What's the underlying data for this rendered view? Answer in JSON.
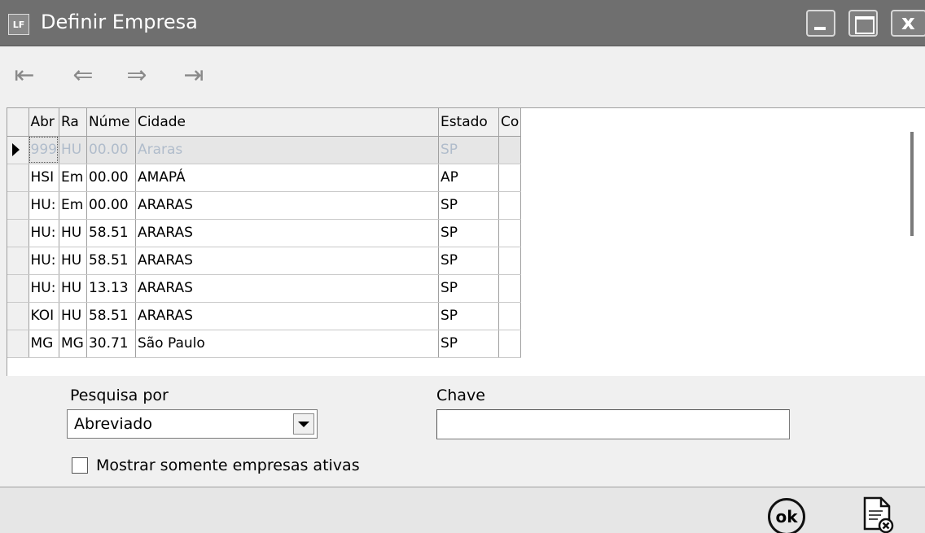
{
  "window": {
    "icon_label": "LF",
    "title": "Definir Empresa",
    "close_label": "x"
  },
  "nav": {
    "first": "⇤",
    "prev": "⇐",
    "next": "⇒",
    "last": "⇥"
  },
  "grid": {
    "headers": [
      "Abr",
      "Ra",
      "Núme",
      "Cidade",
      "Estado",
      "Co"
    ],
    "rows": [
      [
        "999",
        "HU",
        "00.00",
        "Araras",
        "SP",
        ""
      ],
      [
        "HSI",
        "Em",
        "00.00",
        "AMAPÁ",
        "AP",
        ""
      ],
      [
        "HU:",
        "Em",
        "00.00",
        "ARARAS",
        "SP",
        ""
      ],
      [
        "HU:",
        "HU",
        "58.51",
        "ARARAS",
        "SP",
        ""
      ],
      [
        "HU:",
        "HU",
        "58.51",
        "ARARAS",
        "SP",
        ""
      ],
      [
        "HU:",
        "HU",
        "13.13",
        "ARARAS",
        "SP",
        ""
      ],
      [
        "KOI",
        "HU",
        "58.51",
        "ARARAS",
        "SP",
        ""
      ],
      [
        "MG",
        "MG",
        "30.71",
        "São Paulo",
        "SP",
        ""
      ]
    ]
  },
  "search": {
    "by_label": "Pesquisa por",
    "by_value": "Abreviado",
    "key_label": "Chave",
    "key_value": "",
    "active_only_label": "Mostrar somente empresas ativas"
  },
  "footer": {
    "ok_label": "ok"
  },
  "colors": {
    "titlebar": "#6f6f6f",
    "selected_row_text": "#b0bccb"
  }
}
